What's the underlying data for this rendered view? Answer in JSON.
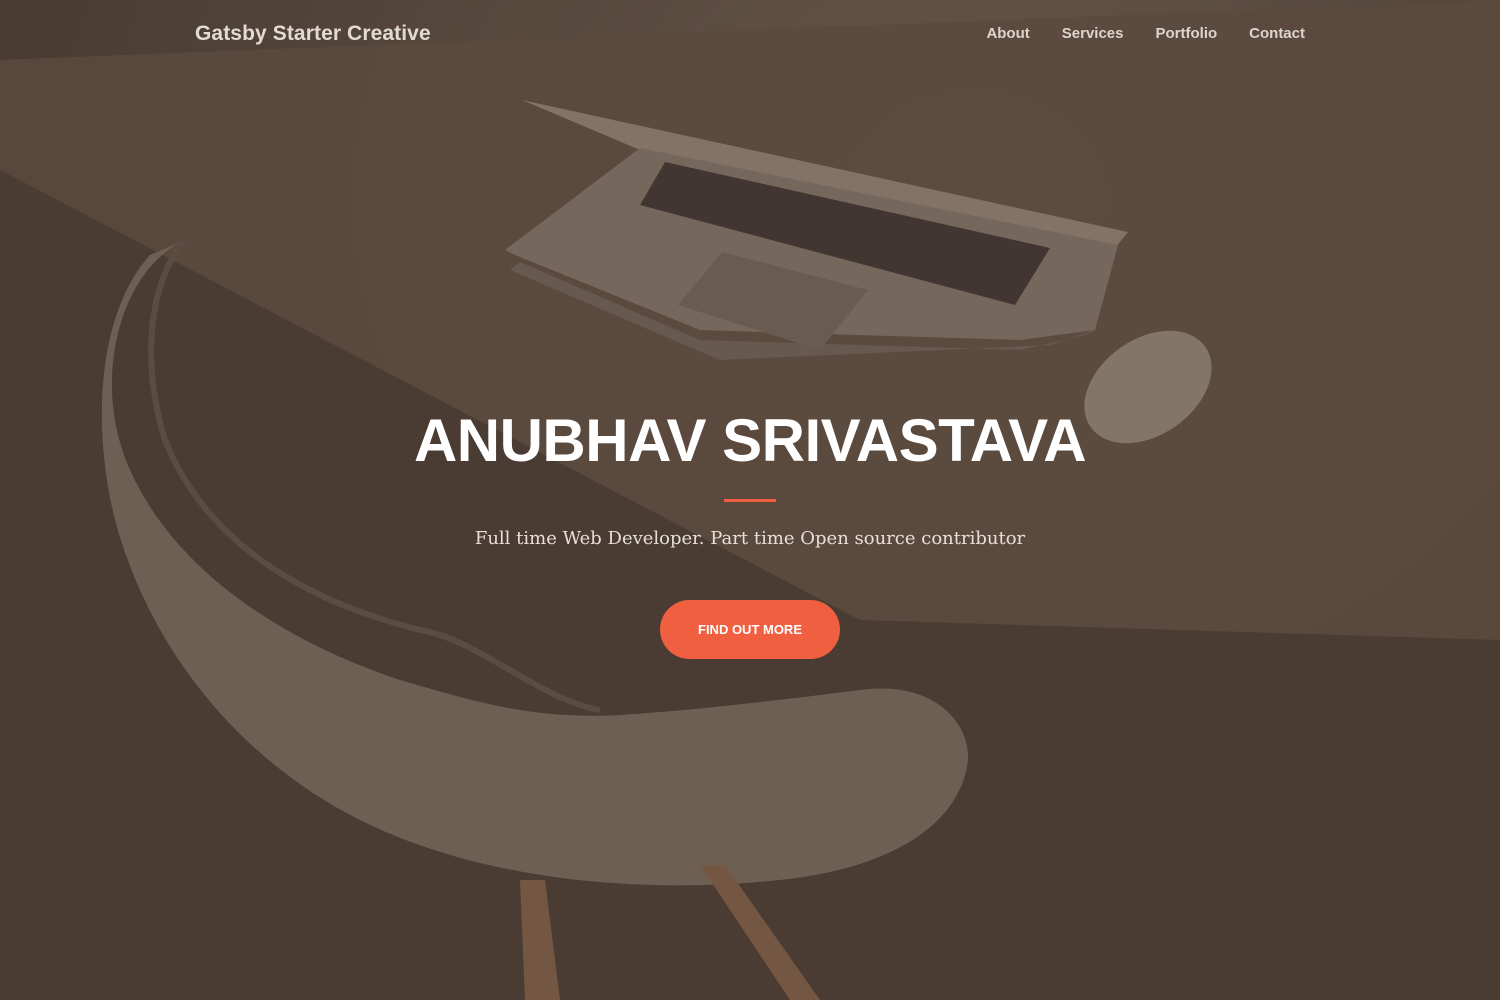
{
  "navbar": {
    "brand": "Gatsby Starter Creative",
    "links": [
      {
        "label": "About"
      },
      {
        "label": "Services"
      },
      {
        "label": "Portfolio"
      },
      {
        "label": "Contact"
      }
    ]
  },
  "hero": {
    "title": "ANUBHAV SRIVASTAVA",
    "subtitle": "Full time Web Developer. Part time Open source contributor",
    "cta_label": "FIND OUT MORE"
  },
  "colors": {
    "accent": "#f05f40",
    "background": "#4d3f36",
    "text": "#ffffff"
  }
}
